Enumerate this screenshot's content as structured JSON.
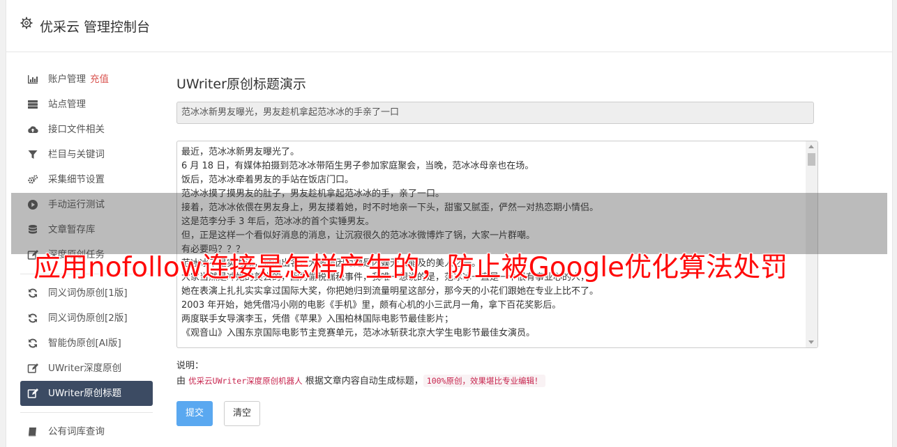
{
  "app": {
    "title": "优采云 管理控制台"
  },
  "sidebar": {
    "items": [
      {
        "label": "账户管理",
        "tag": "充值"
      },
      {
        "label": "站点管理"
      },
      {
        "label": "接口文件相关"
      },
      {
        "label": "栏目与关键词"
      },
      {
        "label": "采集细节设置"
      },
      {
        "label": "手动运行测试"
      },
      {
        "label": "文章暂存库"
      },
      {
        "label": "深度原创任务"
      },
      {
        "label": "同义词伪原创[1版]"
      },
      {
        "label": "同义词伪原创[2版]"
      },
      {
        "label": "智能伪原创[AI版]"
      },
      {
        "label": "UWriter深度原创"
      },
      {
        "label": "UWriter原创标题"
      },
      {
        "label": "公有词库查询"
      }
    ]
  },
  "main": {
    "heading": "UWriter原创标题演示",
    "generated_title": "范冰冰新男友曝光，男友趁机拿起范冰冰的手亲了一口",
    "article_lines": [
      "最近，范冰冰新男友曝光了。",
      "6 月 18 日，有媒体拍摄到范冰冰带陌生男子参加家庭聚会，当晚，范冰冰母亲也在场。",
      "饭后，范冰冰牵着男友的手站在饭店门口。",
      "范冰冰摸了摸男友的肚子，男友趁机拿起范冰冰的手，亲了一口。",
      "接着，范冰冰依偎在男友身上，男友搂着她，时不时地亲一下头，甜蜜又腻歪，俨然一对热恋期小情侣。",
      "这是范李分手 3 年后，范冰冰的首个实锤男友。",
      "但，正是这样一个看似好消息的消息，让沉寂很久的范冰冰微博炸了锅，大家一片群嘲。",
      "有必要吗？？？",
      "范冰冰不是实力派，她的出名，大多是因为她是内娱无人能及的美人之一。",
      "大家当然是冲她的美去的，因为偷税漏税事件，我唯一想说的是，范冰冰一直是一个很有事业心的人，",
      "她在表演上扎扎实实拿过国际大奖，你把她归到流量明星这部分，那今天的小花们跟她在专业上比不了。",
      "2003 年开始，她凭借冯小刚的电影《手机》里，颇有心机的小三武月一角，拿下百花奖影后。",
      "两度联手女导演李玉，凭借《苹果》入围柏林国际电影节最佳影片；",
      "《观音山》入围东京国际电影节主竞赛单元，范冰冰斩获北京大学生电影节最佳女演员。"
    ],
    "note_label": "说明：",
    "note_prefix": "由",
    "note_code1": "优采云UWriter深度原创机器人",
    "note_middle": "根据文章内容自动生成标题，",
    "note_code2": "100%原创，效果堪比专业编辑！",
    "submit_label": "提交",
    "clear_label": "清空"
  },
  "overlay_banner": "应用nofollow连接是怎样产生的，防止被Google优化算法处罚"
}
